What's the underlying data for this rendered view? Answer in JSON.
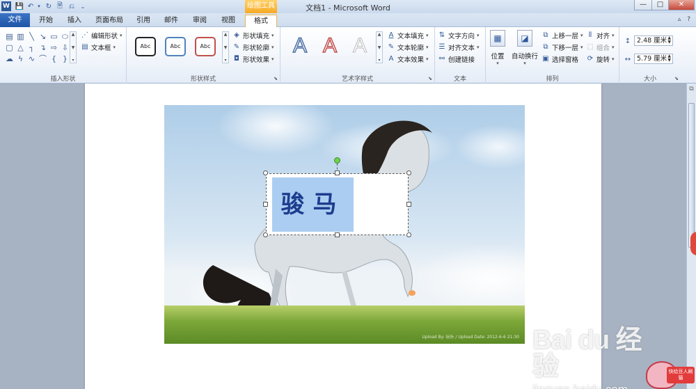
{
  "window": {
    "title": "文档1 - Microsoft Word",
    "context_tools": "绘图工具",
    "buttons": [
      "—",
      "□",
      "✕"
    ]
  },
  "tabs": {
    "file": "文件",
    "items": [
      "开始",
      "插入",
      "页面布局",
      "引用",
      "邮件",
      "审阅",
      "视图"
    ],
    "active": "格式"
  },
  "ribbon": {
    "insert_shapes": {
      "label": "插入形状",
      "edit_shape": "编辑形状",
      "text_box": "文本框"
    },
    "shape_styles": {
      "label": "形状样式",
      "sample_text": [
        "Abc",
        "Abc",
        "Abc"
      ],
      "fill": "形状填充",
      "outline": "形状轮廓",
      "effects": "形状效果"
    },
    "wordart_styles": {
      "label": "艺术字样式",
      "letters": [
        "A",
        "A",
        "A"
      ],
      "text_fill": "文本填充",
      "text_outline": "文本轮廓",
      "text_effects": "文本效果"
    },
    "text": {
      "label": "文本",
      "direction": "文字方向",
      "align": "对齐文本",
      "link": "创建链接"
    },
    "arrange": {
      "label": "排列",
      "position": "位置",
      "wrap": "自动换行",
      "bring_forward": "上移一层",
      "send_backward": "下移一层",
      "selection_pane": "选择窗格",
      "align": "对齐",
      "group": "组合",
      "rotate": "旋转"
    },
    "size": {
      "label": "大小",
      "height": "2.48 厘米",
      "width": "5.79 厘米"
    }
  },
  "document": {
    "textbox_text": "骏马",
    "photo_credit": "Upload By: 玩乐 / Upload Date: 2012-6-6 21:30"
  },
  "watermark": {
    "logo": "Bai du 经验",
    "url": "jingyan.baidu.com",
    "mascot_flag": "快给豆人刷猫"
  },
  "colors": {
    "context_tab": "#f7a923",
    "file_tab": "#1f56a7",
    "textbox_fill": "#abcdf1",
    "textbox_text": "#1c3d8e"
  }
}
